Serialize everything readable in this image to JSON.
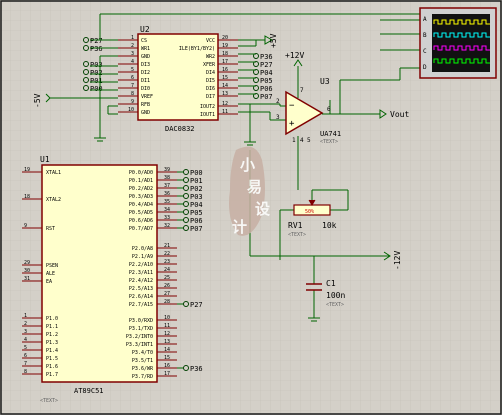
{
  "u2": {
    "ref": "U2",
    "part": "DAC0832",
    "left_pins": [
      {
        "num": "1",
        "name": "CS",
        "net": "P27"
      },
      {
        "num": "2",
        "name": "WR1",
        "net": "P36"
      },
      {
        "num": "3",
        "name": "GND",
        "net": ""
      },
      {
        "num": "4",
        "name": "DI3",
        "net": "P03"
      },
      {
        "num": "5",
        "name": "DI2",
        "net": "P02"
      },
      {
        "num": "6",
        "name": "DI1",
        "net": "P01"
      },
      {
        "num": "7",
        "name": "DI0",
        "net": "P00"
      },
      {
        "num": "8",
        "name": "VREF",
        "net": ""
      },
      {
        "num": "9",
        "name": "RFB",
        "net": ""
      },
      {
        "num": "10",
        "name": "GND",
        "net": ""
      }
    ],
    "right_pins": [
      {
        "num": "20",
        "name": "VCC",
        "net": ""
      },
      {
        "num": "19",
        "name": "ILE(BY1/BY2)",
        "net": ""
      },
      {
        "num": "18",
        "name": "WR2",
        "net": "P36"
      },
      {
        "num": "17",
        "name": "XFER",
        "net": "P27"
      },
      {
        "num": "16",
        "name": "DI4",
        "net": "P04"
      },
      {
        "num": "15",
        "name": "DI5",
        "net": "P05"
      },
      {
        "num": "14",
        "name": "DI6",
        "net": "P06"
      },
      {
        "num": "13",
        "name": "DI7",
        "net": "P07"
      },
      {
        "num": "12",
        "name": "IOUT2",
        "net": ""
      },
      {
        "num": "11",
        "name": "IOUT1",
        "net": ""
      }
    ]
  },
  "u1": {
    "ref": "U1",
    "part": "AT89C51",
    "text_tag": "<TEXT>",
    "left_pins": [
      {
        "num": "19",
        "name": "XTAL1"
      },
      {
        "num": "18",
        "name": "XTAL2"
      },
      {
        "num": "9",
        "name": "RST"
      },
      {
        "num": "29",
        "name": "PSEN"
      },
      {
        "num": "30",
        "name": "ALE"
      },
      {
        "num": "31",
        "name": "EA"
      },
      {
        "num": "1",
        "name": "P1.0"
      },
      {
        "num": "2",
        "name": "P1.1"
      },
      {
        "num": "3",
        "name": "P1.2"
      },
      {
        "num": "4",
        "name": "P1.3"
      },
      {
        "num": "5",
        "name": "P1.4"
      },
      {
        "num": "6",
        "name": "P1.5"
      },
      {
        "num": "7",
        "name": "P1.6"
      },
      {
        "num": "8",
        "name": "P1.7"
      }
    ],
    "right_pins": [
      {
        "num": "39",
        "name": "P0.0/AD0",
        "net": "P00"
      },
      {
        "num": "38",
        "name": "P0.1/AD1",
        "net": "P01"
      },
      {
        "num": "37",
        "name": "P0.2/AD2",
        "net": "P02"
      },
      {
        "num": "36",
        "name": "P0.3/AD3",
        "net": "P03"
      },
      {
        "num": "35",
        "name": "P0.4/AD4",
        "net": "P04"
      },
      {
        "num": "34",
        "name": "P0.5/AD5",
        "net": "P05"
      },
      {
        "num": "33",
        "name": "P0.6/AD6",
        "net": "P06"
      },
      {
        "num": "32",
        "name": "P0.7/AD7",
        "net": "P07"
      },
      {
        "num": "21",
        "name": "P2.0/A8",
        "net": ""
      },
      {
        "num": "22",
        "name": "P2.1/A9",
        "net": ""
      },
      {
        "num": "23",
        "name": "P2.2/A10",
        "net": ""
      },
      {
        "num": "24",
        "name": "P2.3/A11",
        "net": ""
      },
      {
        "num": "25",
        "name": "P2.4/A12",
        "net": ""
      },
      {
        "num": "26",
        "name": "P2.5/A13",
        "net": ""
      },
      {
        "num": "27",
        "name": "P2.6/A14",
        "net": ""
      },
      {
        "num": "28",
        "name": "P2.7/A15",
        "net": "P27"
      },
      {
        "num": "10",
        "name": "P3.0/RXD",
        "net": ""
      },
      {
        "num": "11",
        "name": "P3.1/TXD",
        "net": ""
      },
      {
        "num": "12",
        "name": "P3.2/INT0",
        "net": ""
      },
      {
        "num": "13",
        "name": "P3.3/INT1",
        "net": ""
      },
      {
        "num": "14",
        "name": "P3.4/T0",
        "net": ""
      },
      {
        "num": "15",
        "name": "P3.5/T1",
        "net": ""
      },
      {
        "num": "16",
        "name": "P3.6/WR",
        "net": "P36"
      },
      {
        "num": "17",
        "name": "P3.7/RD",
        "net": ""
      }
    ]
  },
  "u3": {
    "ref": "U3",
    "part": "UA741",
    "text_tag": "<TEXT>",
    "pins": [
      "2",
      "3",
      "6",
      "7",
      "4",
      "1",
      "5"
    ]
  },
  "power": {
    "plus5": "+5V",
    "minus5": "-5V",
    "plus12": "+12V",
    "minus12": "-12V"
  },
  "output": {
    "label": "Vout"
  },
  "pot": {
    "ref": "RV1",
    "value": "10k",
    "position": "50%",
    "text_tag": "<TEXT>"
  },
  "cap": {
    "ref": "C1",
    "value": "100n",
    "text_tag": "<TEXT>"
  },
  "scope": {
    "channels": [
      "A",
      "B",
      "C",
      "D"
    ],
    "trace_colors": [
      "#ffff00",
      "#00ffff",
      "#ff00ff",
      "#00ff00"
    ]
  },
  "colors": {
    "wire": "#006400",
    "component": "#800000",
    "body": "#ffffcc",
    "pin_text": "#000000",
    "terminal": "#004000"
  },
  "watermark": "小易设计"
}
